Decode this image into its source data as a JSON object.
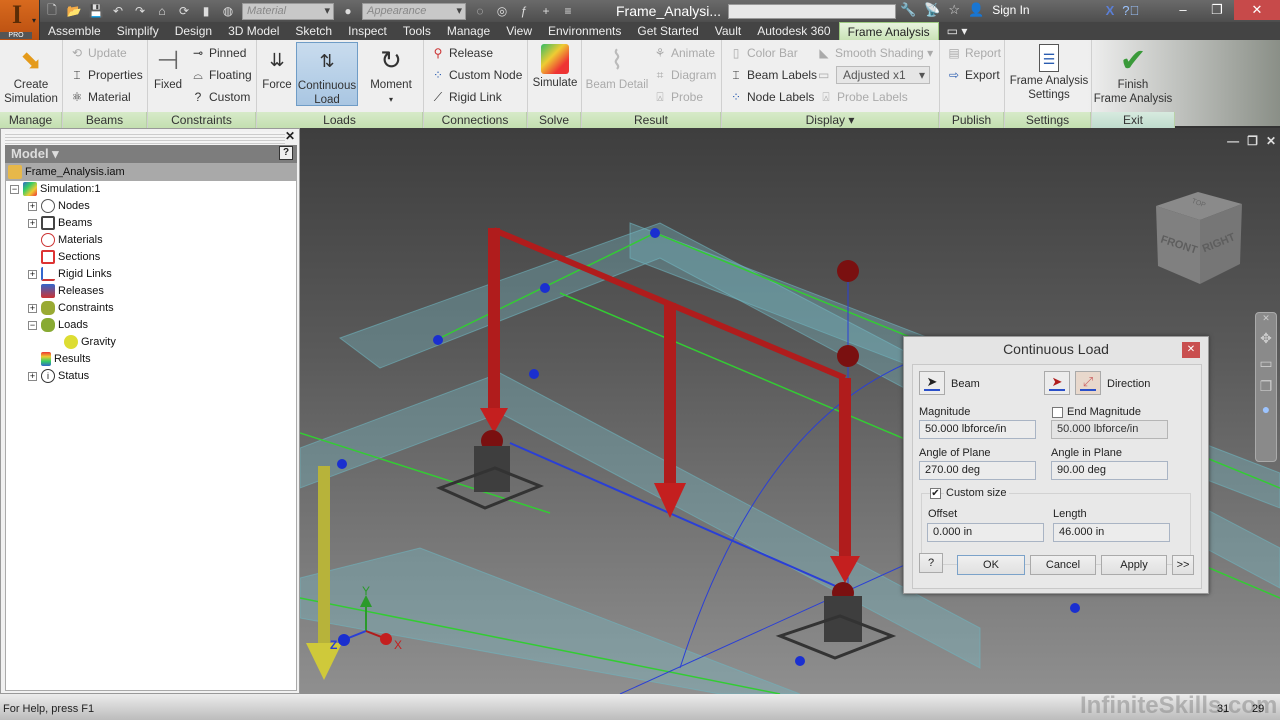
{
  "window": {
    "doc_title": "Frame_Analysi...",
    "app_badge": "PRO",
    "app_letter": "I",
    "material_combo": "Material",
    "appearance_combo": "Appearance",
    "sign_in": "Sign In",
    "minimize": "–",
    "restore": "❐",
    "close": "✕"
  },
  "tabs": [
    "Assemble",
    "Simplify",
    "Design",
    "3D Model",
    "Sketch",
    "Inspect",
    "Tools",
    "Manage",
    "View",
    "Environments",
    "Get Started",
    "Vault",
    "Autodesk 360",
    "Frame Analysis"
  ],
  "active_tab": "Frame Analysis",
  "ribbon": {
    "manage": {
      "title": "Manage",
      "create_simulation": "Create\nSimulation"
    },
    "beams": {
      "title": "Beams",
      "update": "Update",
      "properties": "Properties",
      "material": "Material"
    },
    "constraints": {
      "title": "Constraints",
      "fixed": "Fixed",
      "pinned": "Pinned",
      "floating": "Floating",
      "custom": "Custom"
    },
    "loads": {
      "title": "Loads",
      "force": "Force",
      "continuous_load_1": "Continuous",
      "continuous_load_2": "Load",
      "moment": "Moment"
    },
    "connections": {
      "title": "Connections",
      "release": "Release",
      "custom_node": "Custom Node",
      "rigid_link": "Rigid Link"
    },
    "solve": {
      "title": "Solve",
      "simulate": "Simulate"
    },
    "result": {
      "title": "Result",
      "beam_detail": "Beam Detail",
      "animate": "Animate",
      "diagram": "Diagram",
      "probe": "Probe"
    },
    "display": {
      "title": "Display ▾",
      "color_bar": "Color Bar",
      "smooth_shading": "Smooth Shading",
      "beam_labels": "Beam Labels",
      "adjusted": "Adjusted x1",
      "node_labels": "Node Labels",
      "probe_labels": "Probe Labels"
    },
    "publish": {
      "title": "Publish",
      "report": "Report",
      "export": "Export"
    },
    "settings": {
      "title": "Settings",
      "frame_analysis_settings_1": "Frame Analysis",
      "frame_analysis_settings_2": "Settings"
    },
    "exit": {
      "title": "Exit",
      "finish_1": "Finish",
      "finish_2": "Frame Analysis"
    }
  },
  "browser": {
    "header": "Model ▾",
    "root": "Frame_Analysis.iam",
    "items": [
      {
        "label": "Simulation:1",
        "expander": "−"
      },
      {
        "label": "Nodes",
        "expander": "+"
      },
      {
        "label": "Beams",
        "expander": "+"
      },
      {
        "label": "Materials",
        "expander": ""
      },
      {
        "label": "Sections",
        "expander": ""
      },
      {
        "label": "Rigid Links",
        "expander": "+"
      },
      {
        "label": "Releases",
        "expander": ""
      },
      {
        "label": "Constraints",
        "expander": "+"
      },
      {
        "label": "Loads",
        "expander": "−"
      },
      {
        "label": "Gravity",
        "expander": ""
      },
      {
        "label": "Results",
        "expander": ""
      },
      {
        "label": "Status",
        "expander": "+"
      }
    ]
  },
  "viewcube": {
    "top": "TOP",
    "front": "FRONT",
    "right": "RIGHT"
  },
  "triad": {
    "x": "X",
    "y": "Y",
    "z": "Z"
  },
  "dialog": {
    "title": "Continuous Load",
    "beam_label": "Beam",
    "direction_label": "Direction",
    "magnitude_label": "Magnitude",
    "magnitude_value": "50.000 lbforce/in",
    "end_magnitude_label": "End Magnitude",
    "end_magnitude_checked": false,
    "end_magnitude_value": "50.000 lbforce/in",
    "angle_of_plane_label": "Angle of Plane",
    "angle_of_plane_value": "270.00 deg",
    "angle_in_plane_label": "Angle in Plane",
    "angle_in_plane_value": "90.00 deg",
    "custom_size_label": "Custom size",
    "custom_size_checked": true,
    "offset_label": "Offset",
    "offset_value": "0.000 in",
    "length_label": "Length",
    "length_value": "46.000 in",
    "ok": "OK",
    "cancel": "Cancel",
    "apply": "Apply",
    "more": ">>"
  },
  "status": {
    "help_text": "For Help, press F1",
    "watermark": "InfiniteSkills.com",
    "count1": "31",
    "count2": "29"
  },
  "colors": {
    "load_red": "#b01c1c",
    "node_blue": "#1a2fd0",
    "beam_green": "#33cc33",
    "gravity_yellow": "#b7b33a",
    "ribbon_green": "#c6e0b4"
  }
}
